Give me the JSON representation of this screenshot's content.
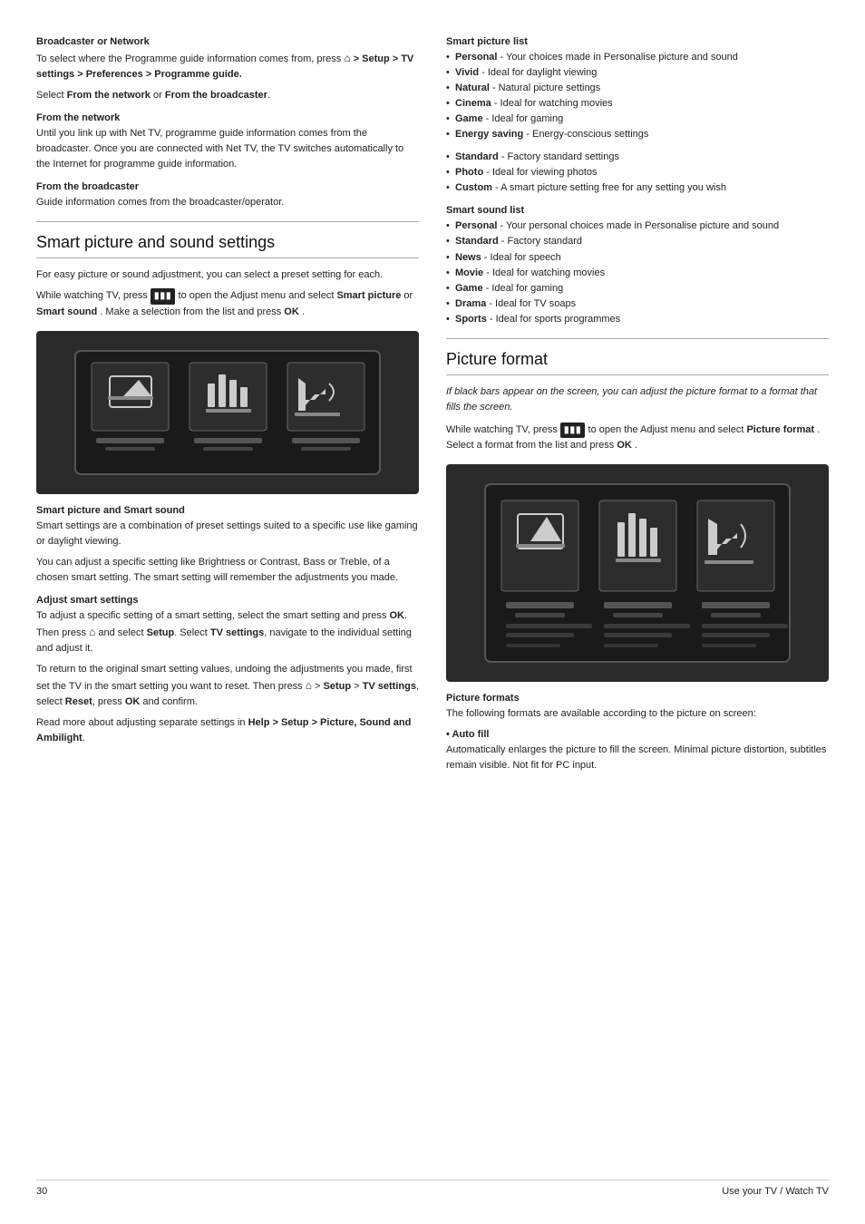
{
  "page": {
    "number": "30",
    "footer_label": "Use your TV / Watch TV"
  },
  "left_col": {
    "broadcaster_section": {
      "heading": "Broadcaster or Network",
      "para1": "To select where the Programme guide information comes from, press",
      "path": "> Setup > TV settings > Preferences > Programme guide.",
      "para2_label": "Select ",
      "from_network_bold": "From the network",
      "or_text": " or ",
      "from_broadcaster_bold": "From the broadcaster",
      "period": ".",
      "from_network_heading": "From the network",
      "from_network_body": "Until you link up with Net TV, programme guide information comes from the broadcaster. Once you are connected with Net TV, the TV switches automatically to the Internet for programme guide information.",
      "from_broadcaster_heading": "From the broadcaster",
      "from_broadcaster_body": "Guide information comes from the broadcaster/operator."
    },
    "smart_section": {
      "heading": "Smart picture and sound settings",
      "intro": "For easy picture or sound adjustment, you can select a preset setting for each.",
      "watch_para_start": "While watching TV, press ",
      "watch_para_mid1": " to open the Adjust menu and select ",
      "smart_picture_bold": "Smart picture",
      "watch_para_mid2": " or ",
      "smart_sound_bold": "Smart sound",
      "watch_para_end": ". Make a selection from the list and press ",
      "ok_bold": "OK",
      "period": "."
    },
    "smart_picture_sound_heading": "Smart picture and Smart sound",
    "smart_picture_sound_body1": "Smart settings are a combination of preset settings suited to a specific use like gaming or daylight viewing.",
    "smart_picture_sound_body2": "You can adjust a specific setting like Brightness or Contrast, Bass or Treble, of a chosen smart setting. The smart setting will remember the adjustments you made.",
    "adjust_heading": "Adjust smart settings",
    "adjust_body1": "To adjust a specific setting of a smart setting, select the smart setting and press ",
    "adjust_ok": "OK",
    "adjust_body1b": ". Then press ",
    "adjust_home": "⌂",
    "adjust_body1c": " and select ",
    "adjust_setup": "Setup",
    "adjust_body1d": ". Select ",
    "adjust_tvsettings": "TV settings",
    "adjust_body1e": ", navigate to the individual setting and adjust it.",
    "adjust_body2_start": "To return to the original smart setting values, undoing the adjustments you made, first set the TV in the smart setting you want to reset. Then press ",
    "adjust_home2": "⌂",
    "adjust_body2_mid1": " > ",
    "adjust_setup2": "Setup",
    "adjust_body2_mid2": " > ",
    "adjust_tvsettings2": "TV settings",
    "adjust_body2_mid3": ", select ",
    "adjust_reset": "Reset",
    "adjust_body2_mid4": ", press ",
    "adjust_ok2": "OK",
    "adjust_body2_end": " and confirm.",
    "read_more_start": "Read more about adjusting separate settings in ",
    "read_more_bold": "Help > Setup > Picture, Sound and Ambilight",
    "read_more_end": "."
  },
  "right_col": {
    "smart_picture_list_heading": "Smart picture list",
    "smart_picture_list": [
      {
        "label": "Personal",
        "desc": " - Your choices made in Personalise picture and sound"
      },
      {
        "label": "Vivid",
        "desc": " - Ideal for daylight viewing"
      },
      {
        "label": "Natural",
        "desc": " - Natural picture settings"
      },
      {
        "label": "Cinema",
        "desc": " - Ideal for watching movies"
      },
      {
        "label": "Game",
        "desc": " - Ideal for gaming"
      },
      {
        "label": "Energy saving",
        "desc": " - Energy-conscious settings"
      }
    ],
    "smart_picture_list2": [
      {
        "label": "Standard",
        "desc": " - Factory standard settings"
      },
      {
        "label": "Photo",
        "desc": " - Ideal for viewing photos"
      },
      {
        "label": "Custom",
        "desc": " - A smart picture setting free for any setting you wish"
      }
    ],
    "smart_sound_list_heading": "Smart sound list",
    "smart_sound_list": [
      {
        "label": "Personal",
        "desc": " - Your personal choices made in Personalise picture and sound"
      },
      {
        "label": "Standard",
        "desc": " - Factory standard"
      },
      {
        "label": "News",
        "desc": " - Ideal for speech"
      },
      {
        "label": "Movie",
        "desc": " - Ideal for watching movies"
      },
      {
        "label": "Game",
        "desc": " - Ideal for gaming"
      },
      {
        "label": "Drama",
        "desc": " - Ideal for TV soaps"
      },
      {
        "label": "Sports",
        "desc": " - Ideal for sports programmes"
      }
    ],
    "picture_format_heading": "Picture format",
    "picture_format_italic": "If black bars appear on the screen, you can adjust the picture format to a format that fills the screen.",
    "picture_format_body_start": "While watching TV, press ",
    "picture_format_body_mid": " to open the Adjust menu and select ",
    "picture_format_bold": "Picture format",
    "picture_format_body_end": ". Select a format from the list and press ",
    "picture_format_ok": "OK",
    "picture_format_period": ".",
    "picture_formats_heading": "Picture formats",
    "picture_formats_body": "The following formats are available according to the picture on screen:",
    "auto_fill_heading": "• Auto fill",
    "auto_fill_body": "Automatically enlarges the picture to fill the screen. Minimal picture distortion, subtitles remain visible. Not fit for PC input."
  }
}
